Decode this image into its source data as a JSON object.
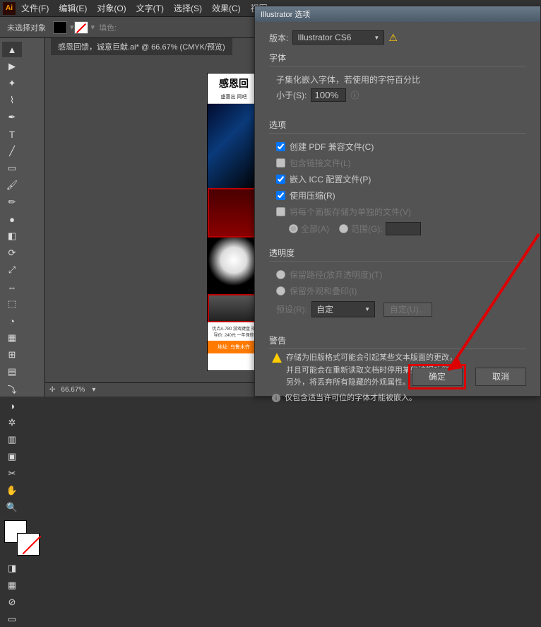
{
  "menubar": {
    "items": [
      "文件(F)",
      "编辑(E)",
      "对象(O)",
      "文字(T)",
      "选择(S)",
      "效果(C)",
      "视图"
    ]
  },
  "optbar": {
    "noSelection": "未选择对象",
    "fillLabel": "填色:"
  },
  "tab": {
    "title": "感恩回馈，诚意巨献.ai* @ 66.67% (CMYK/预览)"
  },
  "artboard": {
    "headline": "感恩回",
    "sub": "盛惠出 网吧",
    "info": "优点A-780 游戏键盘\n指导价: 240元\n一年保修",
    "footer": "地址: 乌鲁木齐"
  },
  "statusbar": {
    "zoom": "66.67%"
  },
  "dialog": {
    "title": "Illustrator 选项",
    "versionLabel": "版本:",
    "versionValue": "Illustrator CS6",
    "fontSection": "字体",
    "fontSubset": "子集化嵌入字体，若使用的字符百分比",
    "lessThan": "小于(S):",
    "lessThanValue": "100%",
    "optionsSection": "选项",
    "opt1": "创建 PDF 兼容文件(C)",
    "opt2": "包含链接文件(L)",
    "opt3": "嵌入 ICC 配置文件(P)",
    "opt4": "使用压缩(R)",
    "opt5": "将每个画板存储为单独的文件(V)",
    "optAll": "全部(A)",
    "optRange": "范围(G):",
    "transSection": "透明度",
    "trans1": "保留路径(放弃透明度)(T)",
    "trans2": "保留外观和叠印(I)",
    "presetLabel": "预设(R):",
    "presetValue": "自定",
    "customBtn": "自定(U)...",
    "warnSection": "警告",
    "warn1": "存储为旧版格式可能会引起某些文本版面的更改，",
    "warn1b": "并且可能会在重新读取文档时停用某些编辑功能。",
    "warn1c": "另外，将丢弃所有隐藏的外观属性。",
    "warn2": "仅包含适当许可位的字体才能被嵌入。",
    "ok": "确定",
    "cancel": "取消"
  }
}
